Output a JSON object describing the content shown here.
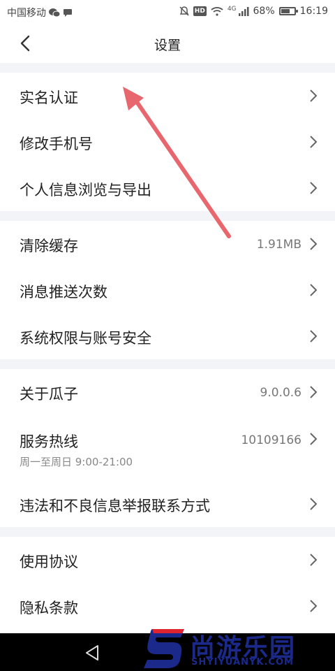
{
  "status_bar": {
    "carrier": "中国移动",
    "network": "4G",
    "battery": "68%",
    "battery_level": 0.68,
    "time": "16:19",
    "hd": "HD"
  },
  "header": {
    "title": "设置",
    "back_icon": "chevron-left-icon"
  },
  "settings": {
    "group1": [
      {
        "label": "实名认证"
      },
      {
        "label": "修改手机号"
      },
      {
        "label": "个人信息浏览与导出"
      }
    ],
    "group2": [
      {
        "label": "清除缓存",
        "value": "1.91MB"
      },
      {
        "label": "消息推送次数"
      },
      {
        "label": "系统权限与账号安全"
      }
    ],
    "group3": [
      {
        "label": "关于瓜子",
        "value": "9.0.0.6"
      },
      {
        "label": "服务热线",
        "value": "10109166",
        "sub": "周一至周日 9:00-21:00"
      },
      {
        "label": "违法和不良信息举报联系方式"
      }
    ],
    "group4": [
      {
        "label": "使用协议"
      },
      {
        "label": "隐私条款"
      }
    ]
  },
  "watermark": {
    "title": "尚游乐园",
    "url": "SHYIYUANYK.COM"
  },
  "colors": {
    "background": "#ffffff",
    "section_gap": "#f2f4f8",
    "annotation_arrow": "#e8676f",
    "watermark_blue": "#1b2a8a",
    "watermark_red": "#e0242f"
  }
}
